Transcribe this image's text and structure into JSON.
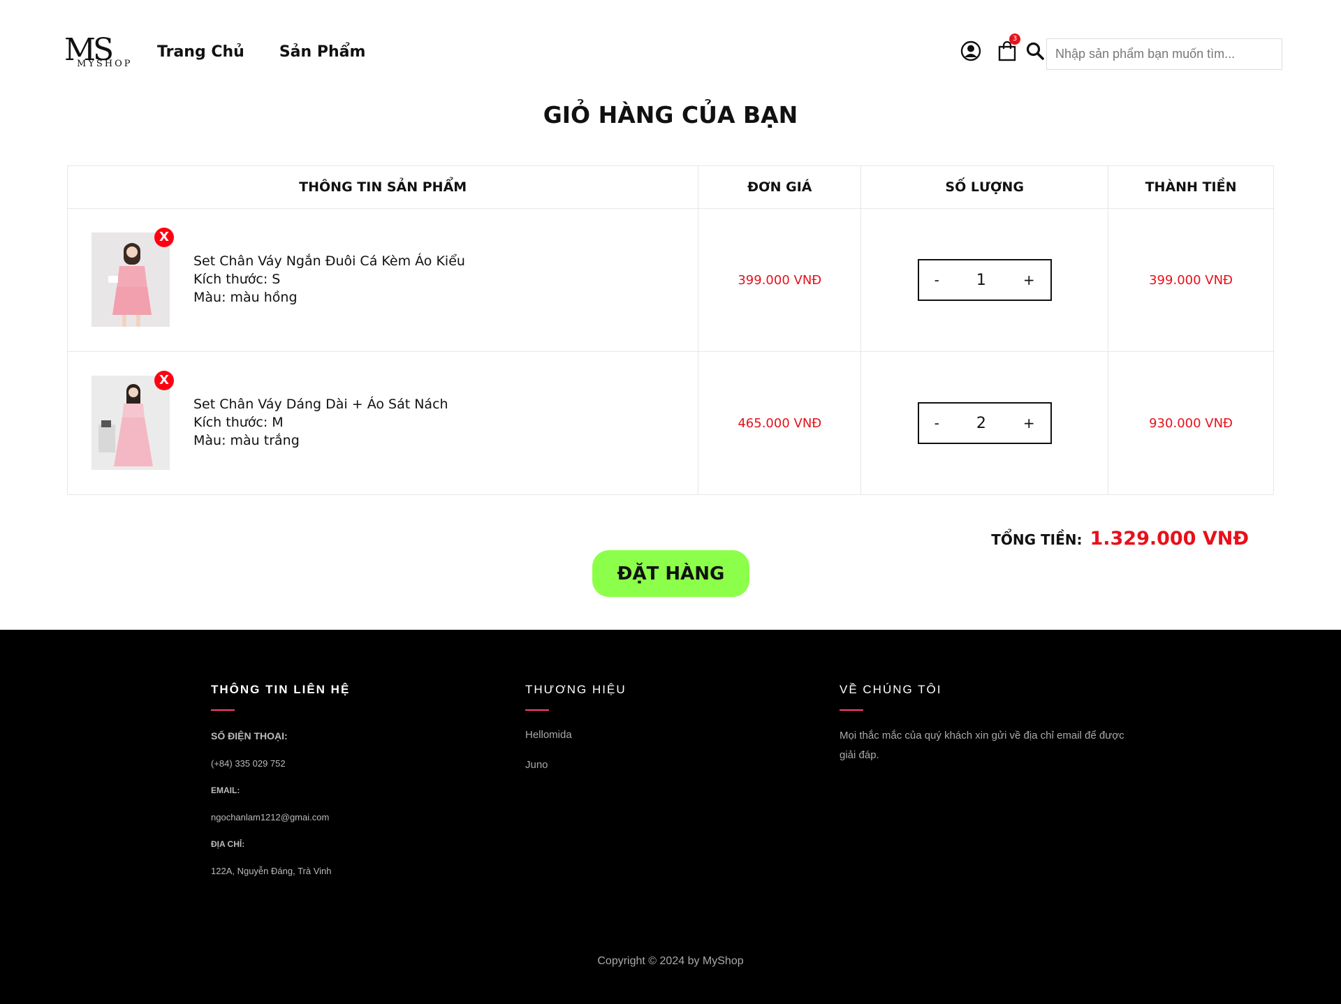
{
  "header": {
    "logo_text": "MS",
    "logo_subtext": "MYSHOP",
    "nav": [
      "Trang Chủ",
      "Sản Phẩm"
    ],
    "cart_count": "3",
    "search_placeholder": "Nhập sản phẩm bạn muốn tìm..."
  },
  "page_title": "GIỎ HÀNG CỦA BẠN",
  "table": {
    "headers": [
      "THÔNG TIN SẢN PHẨM",
      "ĐƠN GIÁ",
      "SỐ LƯỢNG",
      "THÀNH TIỀN"
    ],
    "rows": [
      {
        "name": "Set Chân Váy Ngắn Đuôi Cá Kèm Áo Kiểu",
        "size": "Kích thước: S",
        "color": "Màu: màu hồng",
        "unit_price": "399.000 VNĐ",
        "qty": "1",
        "subtotal": "399.000 VNĐ"
      },
      {
        "name": "Set Chân Váy Dáng Dài + Áo Sát Nách",
        "size": "Kích thước: M",
        "color": "Màu: màu trắng",
        "unit_price": "465.000 VNĐ",
        "qty": "2",
        "subtotal": "930.000 VNĐ"
      }
    ],
    "remove_label": "X",
    "minus": "-",
    "plus": "+"
  },
  "total": {
    "label": "TỔNG TIỀN:",
    "amount": "1.329.000 VNĐ"
  },
  "order_button": "ĐẶT HÀNG",
  "footer": {
    "contact": {
      "title": "THÔNG TIN LIÊN HỆ",
      "phone_label": "SỐ ĐIỆN THOẠI:",
      "phone": "(+84) 335 029 752",
      "email_label": "EMAIL:",
      "email": "ngochanlam1212@gmai.com",
      "address_label": "ĐỊA CHỈ:",
      "address": "122A, Nguyễn Đáng, Trà Vinh"
    },
    "brands": {
      "title": "THƯƠNG HIỆU",
      "items": [
        "Hellomida",
        "Juno"
      ]
    },
    "about": {
      "title": "VỀ CHÚNG TÔI",
      "text": "Mọi thắc mắc của quý khách xin gửi về địa chỉ email để được giải đáp."
    },
    "copyright": "Copyright © 2024 by MyShop"
  },
  "colors": {
    "accent_red": "#e8101a",
    "order_green": "#8cff4a",
    "footer_bg": "#000000",
    "footer_line": "#ff3f7f"
  }
}
